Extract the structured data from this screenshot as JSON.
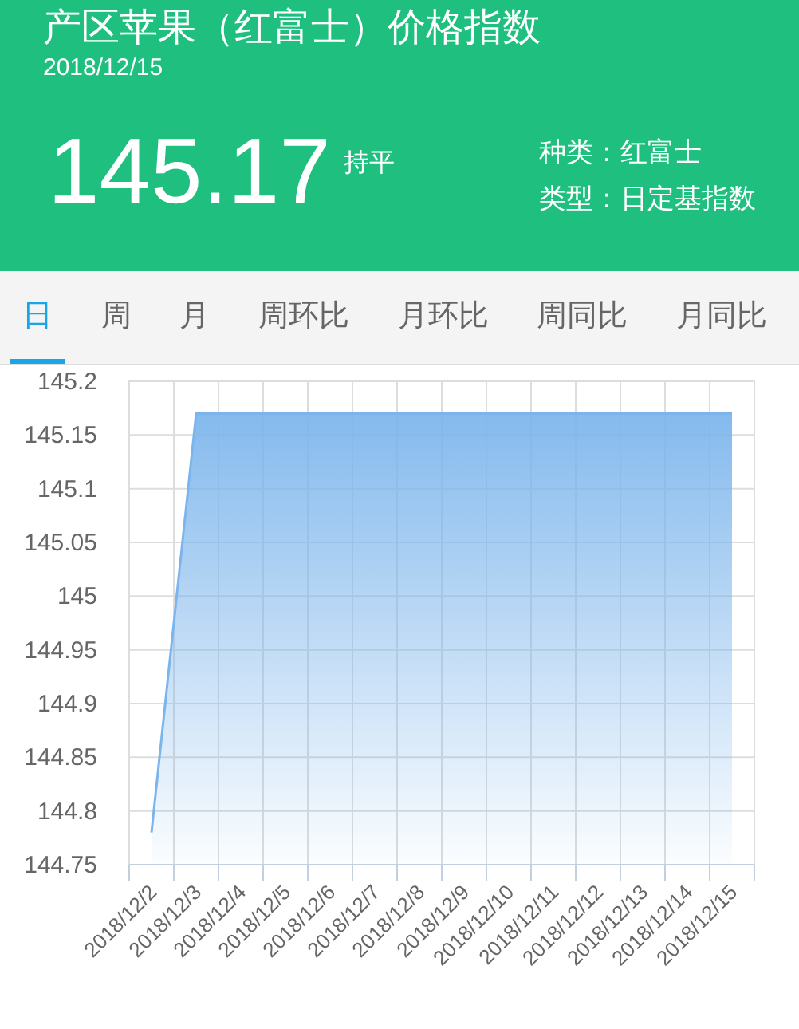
{
  "header": {
    "title": "产区苹果（红富士）价格指数",
    "date": "2018/12/15",
    "value": "145.17",
    "trend": "持平",
    "info": [
      {
        "label": "种类：",
        "value": "红富士"
      },
      {
        "label": "类型：",
        "value": "日定基指数"
      }
    ]
  },
  "tabs": [
    {
      "label": "日",
      "selected": true
    },
    {
      "label": "周",
      "selected": false
    },
    {
      "label": "月",
      "selected": false
    },
    {
      "label": "周环比",
      "selected": false
    },
    {
      "label": "月环比",
      "selected": false
    },
    {
      "label": "周同比",
      "selected": false
    },
    {
      "label": "月同比",
      "selected": false
    }
  ],
  "chart_data": {
    "type": "area",
    "categories": [
      "2018/12/2",
      "2018/12/3",
      "2018/12/4",
      "2018/12/5",
      "2018/12/6",
      "2018/12/7",
      "2018/12/8",
      "2018/12/9",
      "2018/12/10",
      "2018/12/11",
      "2018/12/12",
      "2018/12/13",
      "2018/12/14",
      "2018/12/15"
    ],
    "grid": true,
    "series": [
      {
        "color": "#7cb5ec",
        "values": [
          144.78,
          145.17,
          145.17,
          145.17,
          145.17,
          145.17,
          145.17,
          145.17,
          145.17,
          145.17,
          145.17,
          145.17,
          145.17,
          145.17
        ]
      }
    ],
    "ylim": [
      144.75,
      145.2
    ],
    "yticks": [
      {
        "value": 144.75,
        "label": "144.75"
      },
      {
        "value": 144.8,
        "label": "144.8"
      },
      {
        "value": 144.85,
        "label": "144.85"
      },
      {
        "value": 144.9,
        "label": "144.9"
      },
      {
        "value": 144.95,
        "label": "144.95"
      },
      {
        "value": 145,
        "label": "145"
      },
      {
        "value": 145.05,
        "label": "145.05"
      },
      {
        "value": 145.1,
        "label": "145.1"
      },
      {
        "value": 145.15,
        "label": "145.15"
      },
      {
        "value": 145.2,
        "label": "145.2"
      }
    ]
  }
}
